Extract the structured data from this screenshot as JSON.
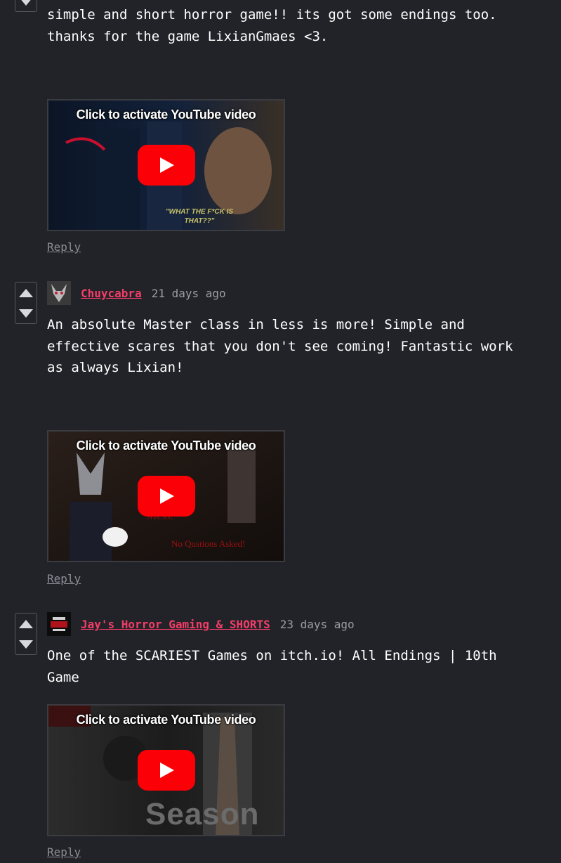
{
  "colors": {
    "background": "#222329",
    "author_link": "#f23d68",
    "reply_link": "#8d8e95",
    "youtube_red": "#fb0007"
  },
  "comments": [
    {
      "body_lines": [
        "simple and short horror game!! its got some endings too.",
        "thanks for the game LixianGmaes <3."
      ],
      "video": {
        "caption": "Click to activate YouTube video",
        "overlay_text": "\"WHAT THE F*CK IS THAT??\""
      },
      "reply_label": "Reply"
    },
    {
      "author": "Chuycabra",
      "time": "21 days ago",
      "body_lines": [
        "An absolute Master class in less is more! Simple and",
        "effective scares that you don't see coming! Fantastic work",
        "as always Lixian!"
      ],
      "video": {
        "caption": "Click to activate YouTube video",
        "overlay_text": "No Qustions Asked!",
        "overlay_text_2": "Mess."
      },
      "reply_label": "Reply"
    },
    {
      "author": "Jay's Horror Gaming & SHORTS",
      "time": "23 days ago",
      "body_lines": [
        "One of the SCARIEST Games on itch.io! All Endings | 10th",
        "Game"
      ],
      "video": {
        "caption": "Click to activate YouTube video",
        "overlay_text": "Season 1"
      },
      "reply_label": "Reply"
    }
  ]
}
